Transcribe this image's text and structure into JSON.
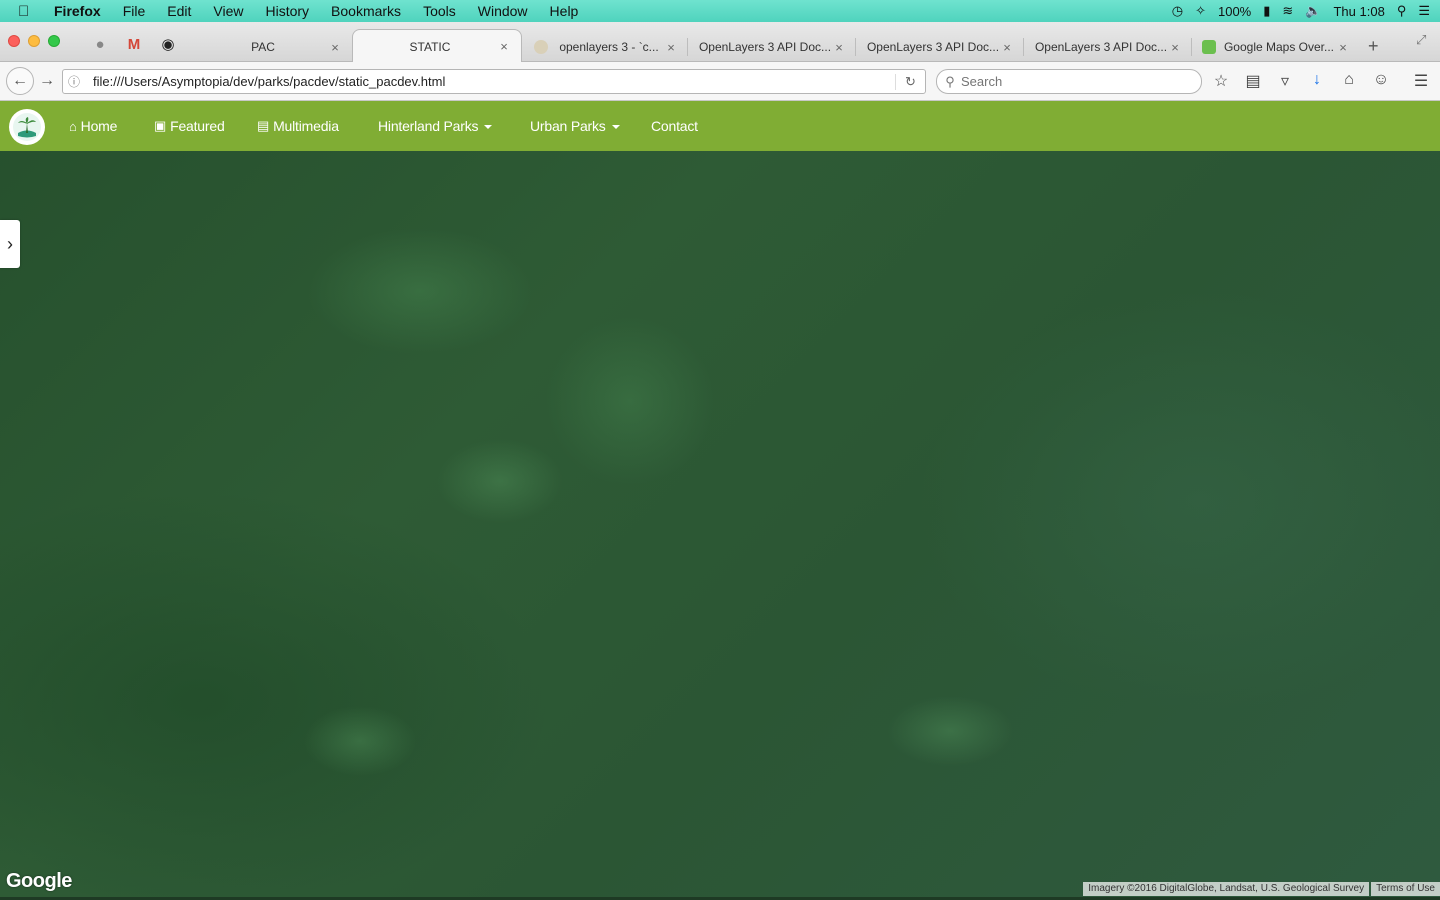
{
  "menubar": {
    "app": "Firefox",
    "items": [
      "File",
      "Edit",
      "View",
      "History",
      "Bookmarks",
      "Tools",
      "Window",
      "Help"
    ],
    "battery": "100%",
    "clock": "Thu 1:08"
  },
  "tabs": [
    {
      "title": "PAC",
      "close": "×"
    },
    {
      "title": "STATIC",
      "close": "×",
      "active": true
    },
    {
      "title": "openlayers 3 - `c...",
      "close": "×"
    },
    {
      "title": "OpenLayers 3 API Doc...",
      "close": "×"
    },
    {
      "title": "OpenLayers 3 API Doc...",
      "close": "×"
    },
    {
      "title": "OpenLayers 3 API Doc...",
      "close": "×"
    },
    {
      "title": "Google Maps Over...",
      "close": "×"
    }
  ],
  "toolbar": {
    "url": "file:///Users/Asymptopia/dev/parks/pacdev/static_pacdev.html",
    "search_placeholder": "Search"
  },
  "site": {
    "nav": {
      "home": "Home",
      "featured": "Featured",
      "multimedia": "Multimedia",
      "hinterland": "Hinterland Parks",
      "urban": "Urban Parks",
      "contact": "Contact"
    },
    "nav_color": "#80ad34",
    "map": {
      "google_logo": "Google",
      "attribution": "Imagery ©2016 DigitalGlobe, Landsat, U.S. Geological Survey",
      "terms": "Terms of Use"
    }
  },
  "icons": [
    "apple-icon",
    "globe-icon",
    "gmail-icon",
    "github-icon",
    "back-icon",
    "forward-icon",
    "info-icon",
    "reload-icon",
    "search-icon",
    "star-icon",
    "reading-list-icon",
    "pocket-icon",
    "download-icon",
    "home-icon",
    "chat-icon",
    "menu-icon",
    "chevron-right-icon"
  ]
}
